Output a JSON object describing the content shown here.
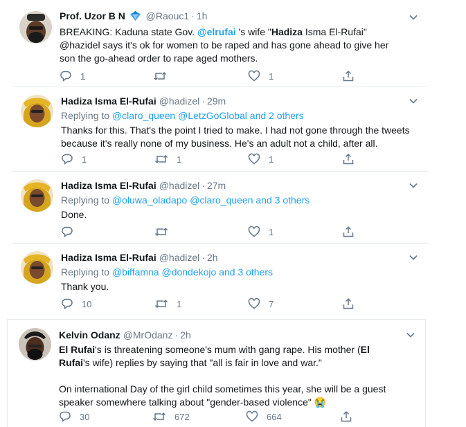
{
  "tweets": [
    {
      "name": "Prof. Uzor B N",
      "verified": true,
      "handle": "@Raouc1",
      "time": "1h",
      "text_parts": [
        {
          "t": "BREAKING: Kaduna state Gov. ",
          "s": "plain"
        },
        {
          "t": "@elrufai",
          "s": "mention"
        },
        {
          "t": " 's wife \"",
          "s": "plain"
        },
        {
          "t": "Hadiza",
          "s": "bold"
        },
        {
          "t": " Isma El-Rufai\" @hazidel says it's ok for women to be raped and has gone ahead to give her son the go-ahead order to rape aged mothers.",
          "s": "plain"
        }
      ],
      "replies": "1",
      "retweets": "",
      "likes": "1"
    },
    {
      "name": "Hadiza Isma El-Rufai",
      "handle": "@hadizel",
      "time": "29m",
      "replying_prefix": "Replying to",
      "replying_to": "@claro_queen @LetzGoGlobal and 2 others",
      "text": "Thanks for this. That's the point I tried to make. I had not gone through the tweets because it's really none of my business. He's an adult not a child, after all.",
      "replies": "1",
      "retweets": "1",
      "likes": "1"
    },
    {
      "name": "Hadiza Isma El-Rufai",
      "handle": "@hadizel",
      "time": "27m",
      "replying_prefix": "Replying to",
      "replying_to": "@oluwa_oladapo @claro_queen and 3 others",
      "text": "Done.",
      "replies": "",
      "retweets": "",
      "likes": "1"
    },
    {
      "name": "Hadiza Isma El-Rufai",
      "handle": "@hadizel",
      "time": "2h",
      "replying_prefix": "Replying to",
      "replying_to": "@biffamna @dondekojo and 3 others",
      "text": "Thank you.",
      "replies": "10",
      "retweets": "1",
      "likes": "7"
    },
    {
      "name": "Kelvin Odanz",
      "handle": "@MrOdanz",
      "time": "2h",
      "para1_parts": [
        {
          "t": "El Rufai",
          "s": "bold"
        },
        {
          "t": "'s is threatening someone's mum with gang rape. His mother (",
          "s": "plain"
        },
        {
          "t": "El Rufai",
          "s": "bold"
        },
        {
          "t": "'s wife) replies by saying that \"all is fair in love and war.\"",
          "s": "plain"
        }
      ],
      "para2": "On international Day of the girl child sometimes this year, she will be a guest speaker somewhere talking about \"gender-based violence\" 😭",
      "replies": "30",
      "retweets": "672",
      "likes": "664"
    }
  ],
  "icons": {
    "reply": "reply-icon",
    "retweet": "retweet-icon",
    "like": "heart-icon",
    "share": "share-icon",
    "more": "chevron-down-icon",
    "verified": "verified-badge-icon"
  },
  "colors": {
    "link": "#1da1f2",
    "muted": "#657786",
    "text": "#14171a",
    "border": "#e6ecf0",
    "verified": "#1da1f2"
  }
}
